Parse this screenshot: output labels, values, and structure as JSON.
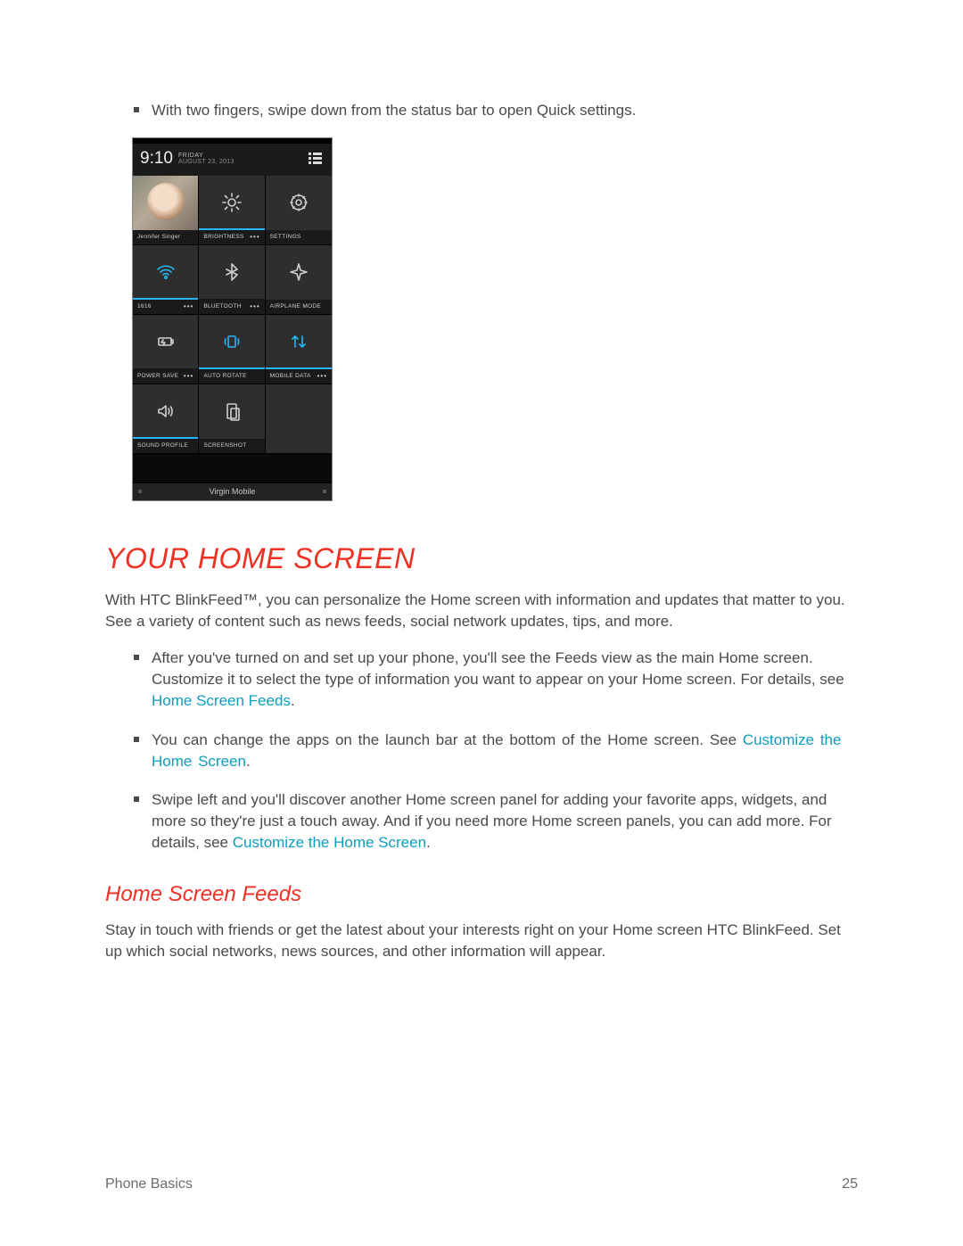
{
  "intro_bullet": "With two fingers, swipe down from the status bar to open Quick settings.",
  "phone": {
    "time": "9:10",
    "day": "FRIDAY",
    "date": "AUGUST 23, 2013",
    "carrier": "Virgin Mobile",
    "tiles": [
      {
        "label": "Jennifer Singer",
        "icon": "profile",
        "active": false,
        "dots": false
      },
      {
        "label": "BRIGHTNESS",
        "icon": "brightness",
        "active": false,
        "dots": true,
        "accent": true
      },
      {
        "label": "SETTINGS",
        "icon": "settings",
        "active": false,
        "dots": false
      },
      {
        "label": "1616",
        "icon": "wifi",
        "active": true,
        "dots": true,
        "accent": true
      },
      {
        "label": "BLUETOOTH",
        "icon": "bluetooth",
        "active": false,
        "dots": true
      },
      {
        "label": "AIRPLANE MODE",
        "icon": "airplane",
        "active": false,
        "dots": false
      },
      {
        "label": "POWER SAVE",
        "icon": "powersave",
        "active": false,
        "dots": true
      },
      {
        "label": "AUTO ROTATE",
        "icon": "rotate",
        "active": true,
        "dots": false,
        "accent": true
      },
      {
        "label": "MOBILE DATA",
        "icon": "mobiledata",
        "active": true,
        "dots": true,
        "accent": true
      },
      {
        "label": "SOUND PROFILE",
        "icon": "sound",
        "active": false,
        "dots": false,
        "accent": true
      },
      {
        "label": "SCREENSHOT",
        "icon": "screenshot",
        "active": false,
        "dots": false
      }
    ]
  },
  "section1_title": "YOUR HOME SCREEN",
  "section1_para": "With HTC BlinkFeed™, you can personalize the Home screen with information and updates that matter to you. See a variety of content such as news feeds, social network updates, tips, and more.",
  "section1_bullets": {
    "b1_pre": "After you've turned on and set up your phone, you'll see the Feeds view as the main Home screen. Customize it to select the type of information you want to appear on your Home screen. For details, see ",
    "b1_link": "Home Screen Feeds",
    "b1_post": ".",
    "b2_pre": "You can change the apps on the launch bar at the bottom of the Home screen. See ",
    "b2_link": "Customize the Home Screen",
    "b2_post": ".",
    "b3_pre": "Swipe left and you'll discover another Home screen panel for adding your favorite apps, widgets, and more so they're just a touch away. And if you need more Home screen panels, you can add more. For details, see ",
    "b3_link": "Customize the Home Screen",
    "b3_post": "."
  },
  "section2_title": "Home Screen Feeds",
  "section2_para": "Stay in touch with friends or get the latest about your interests right on your Home screen HTC BlinkFeed. Set up which social networks, news sources, and other information will appear.",
  "footer_left": "Phone Basics",
  "footer_right": "25"
}
